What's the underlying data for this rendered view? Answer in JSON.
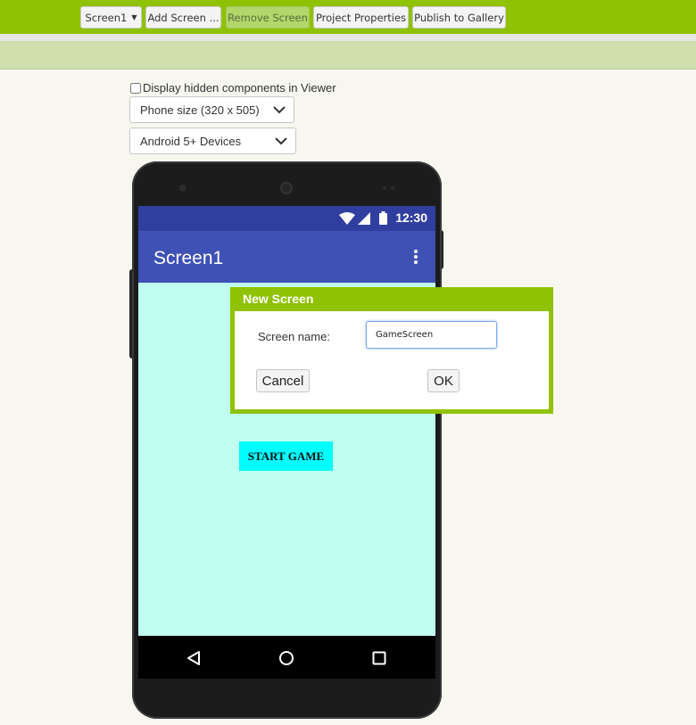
{
  "toolbar": {
    "screen_select": "Screen1",
    "add_screen": "Add Screen ...",
    "remove_screen": "Remove Screen",
    "project_properties": "Project Properties",
    "publish_gallery": "Publish to Gallery"
  },
  "viewer": {
    "hidden_components_label": "Display hidden components in Viewer",
    "phone_size": "Phone size (320 x 505)",
    "device_type": "Android 5+ Devices"
  },
  "phone": {
    "clock": "12:30",
    "screen_title": "Screen1",
    "start_button": "START GAME"
  },
  "dialog": {
    "title": "New Screen",
    "name_label": "Screen name:",
    "name_value": "GameScreen",
    "cancel": "Cancel",
    "ok": "OK"
  },
  "colors": {
    "toolbar_green": "#8fc202",
    "statusbar": "#303f9f",
    "appbar": "#3f51b5",
    "screen_bg": "#c0fdf0",
    "start_button": "#00ffff"
  }
}
